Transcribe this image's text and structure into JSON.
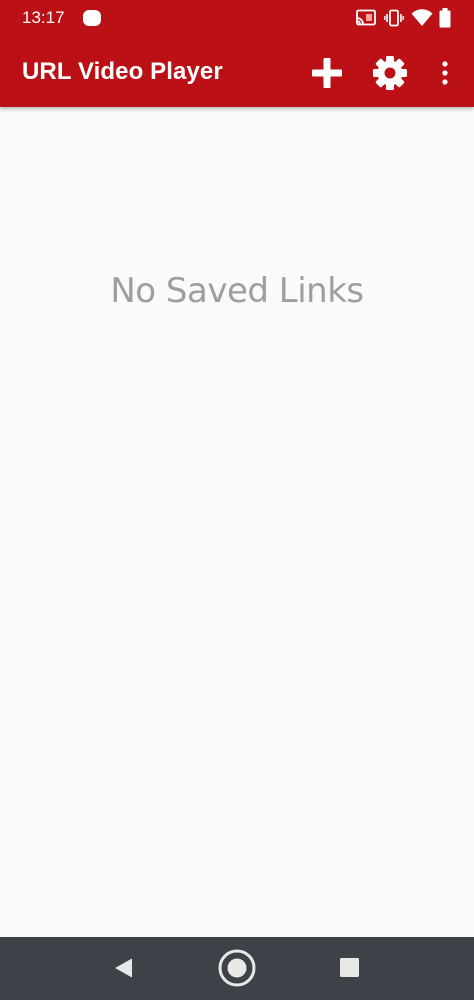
{
  "status_bar": {
    "time": "13:17"
  },
  "app_bar": {
    "title": "URL Video Player",
    "background_color": "#bb1116",
    "actions": [
      {
        "name": "add",
        "icon": "plus-icon"
      },
      {
        "name": "settings",
        "icon": "gear-icon"
      },
      {
        "name": "more",
        "icon": "more-vertical-icon"
      }
    ]
  },
  "main": {
    "empty_message": "No Saved Links"
  },
  "nav_bar": {
    "buttons": [
      {
        "name": "back",
        "icon": "back-triangle-icon"
      },
      {
        "name": "home",
        "icon": "home-circle-icon"
      },
      {
        "name": "recents",
        "icon": "recents-square-icon"
      }
    ]
  }
}
